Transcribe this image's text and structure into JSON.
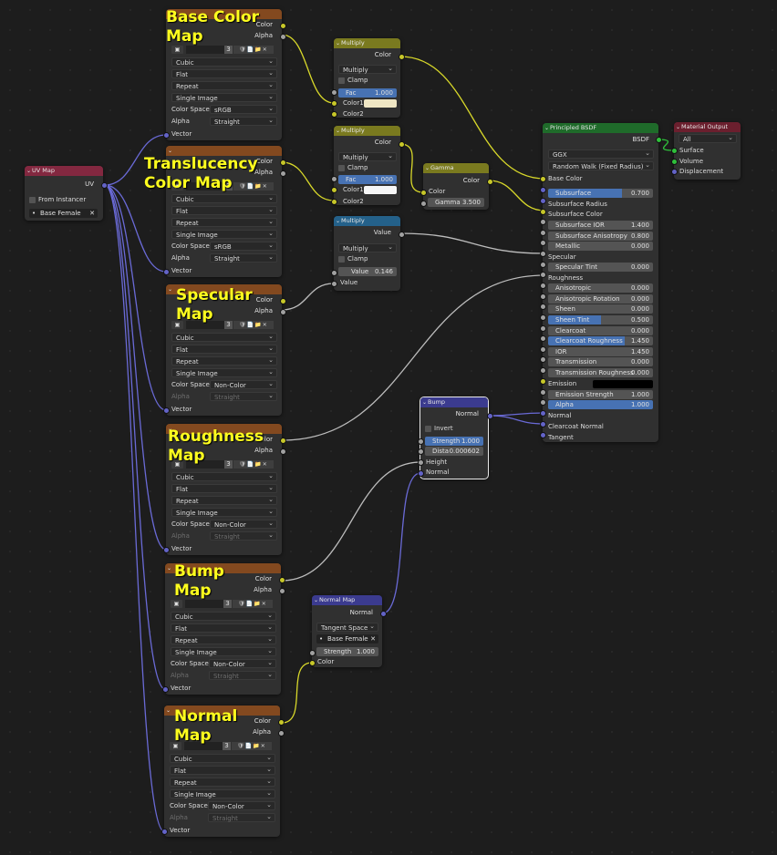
{
  "uv_node": {
    "title": "UV Map",
    "output": "UV",
    "from_instancer": "From Instancer",
    "uv_map": "Base Female",
    "close": "✕",
    "dot": "•"
  },
  "image_common": {
    "interpolation": "Cubic",
    "projection": "Flat",
    "extension": "Repeat",
    "source": "Single Image",
    "color_space_label": "Color Space",
    "alpha_label": "Alpha",
    "vector_label": "Vector",
    "out_color": "Color",
    "out_alpha": "Alpha",
    "users": "3",
    "tools": "🛡📄📁✕"
  },
  "images": [
    {
      "name": "Base Color Map",
      "title1": "Base Color",
      "title2": "Map",
      "color_space": "sRGB",
      "alpha": "Straight"
    },
    {
      "name": "Translucency Color Map",
      "title1": "Translucency",
      "title2": "Color Map",
      "color_space": "sRGB",
      "alpha": "Straight"
    },
    {
      "name": "Specular Map",
      "title1": "Specular",
      "title2": "Map",
      "color_space": "Non-Color",
      "alpha": "Straight"
    },
    {
      "name": "Roughness Map",
      "title1": "Roughness",
      "title2": "Map",
      "color_space": "Non-Color",
      "alpha": "Straight"
    },
    {
      "name": "Bump Map",
      "title1": "Bump",
      "title2": "Map",
      "color_space": "Non-Color",
      "alpha": "Straight"
    },
    {
      "name": "Normal Map",
      "title1": "Normal",
      "title2": "Map",
      "color_space": "Non-Color",
      "alpha": "Straight"
    }
  ],
  "multiply1": {
    "title": "Multiply",
    "out": "Color",
    "op": "Multiply",
    "clamp": "Clamp",
    "fac_label": "Fac",
    "fac": "1.000",
    "color1": "Color1",
    "color2": "Color2",
    "swatch": "#efe6c4"
  },
  "multiply2": {
    "title": "Multiply",
    "out": "Color",
    "op": "Multiply",
    "clamp": "Clamp",
    "fac_label": "Fac",
    "fac": "1.000",
    "color1": "Color1",
    "color2": "Color2",
    "swatch": "#f6f6f6"
  },
  "multiply3": {
    "title": "Multiply",
    "out": "Value",
    "op": "Multiply",
    "clamp": "Clamp",
    "value_label": "Value",
    "value": "0.146",
    "in_value": "Value"
  },
  "gamma": {
    "title": "Gamma",
    "out": "Color",
    "in_color": "Color",
    "gamma_label": "Gamma",
    "gamma": "3.500"
  },
  "bump": {
    "title": "Bump",
    "out": "Normal",
    "invert": "Invert",
    "strength_label": "Strength",
    "strength": "1.000",
    "dist_label": "Dista",
    "dist": "0.000602",
    "height": "Height",
    "normal": "Normal"
  },
  "normal_map": {
    "title": "Normal Map",
    "out": "Normal",
    "space": "Tangent Space",
    "uv": "Base Female",
    "strength_label": "Strength",
    "strength": "1.000",
    "in_color": "Color"
  },
  "bsdf": {
    "title": "Principled BSDF",
    "out": "BSDF",
    "distribution": "GGX",
    "subsurface_method": "Random Walk (Fixed Radius)",
    "base_color": "Base Color",
    "subsurface": {
      "label": "Subsurface",
      "value": "0.700",
      "fill": 0.7
    },
    "subsurface_radius": "Subsurface Radius",
    "subsurface_color": "Subsurface Color",
    "subsurface_ior": {
      "label": "Subsurface IOR",
      "value": "1.400"
    },
    "subsurface_anisotropy": {
      "label": "Subsurface Anisotropy",
      "value": "0.800"
    },
    "metallic": {
      "label": "Metallic",
      "value": "0.000"
    },
    "specular": "Specular",
    "specular_tint": {
      "label": "Specular Tint",
      "value": "0.000"
    },
    "roughness": "Roughness",
    "anisotropic": {
      "label": "Anisotropic",
      "value": "0.000"
    },
    "anisotropic_rotation": {
      "label": "Anisotropic Rotation",
      "value": "0.000"
    },
    "sheen": {
      "label": "Sheen",
      "value": "0.000"
    },
    "sheen_tint": {
      "label": "Sheen Tint",
      "value": "0.500",
      "fill": 0.5
    },
    "clearcoat": {
      "label": "Clearcoat",
      "value": "0.000"
    },
    "clearcoat_roughness": {
      "label": "Clearcoat Roughness",
      "value": "1.450",
      "fill": 0.73
    },
    "ior": {
      "label": "IOR",
      "value": "1.450"
    },
    "transmission": {
      "label": "Transmission",
      "value": "0.000"
    },
    "transmission_roughness": {
      "label": "Transmission Roughness",
      "value": "0.000"
    },
    "emission": "Emission",
    "emission_strength": {
      "label": "Emission Strength",
      "value": "1.000"
    },
    "alpha": {
      "label": "Alpha",
      "value": "1.000"
    },
    "normal": "Normal",
    "clearcoat_normal": "Clearcoat Normal",
    "tangent": "Tangent"
  },
  "output": {
    "title": "Material Output",
    "target": "All",
    "surface": "Surface",
    "volume": "Volume",
    "displacement": "Displacement"
  },
  "colors": {
    "texture_header": "#83491f",
    "converter_header": "#7a7a1f",
    "mathheader": "#24618a",
    "vector_header": "#3b3b8f",
    "shader_header": "#1f6b2a",
    "output_header": "#6b1f2e",
    "uv_header": "#832840",
    "label": "#ffff1e"
  }
}
